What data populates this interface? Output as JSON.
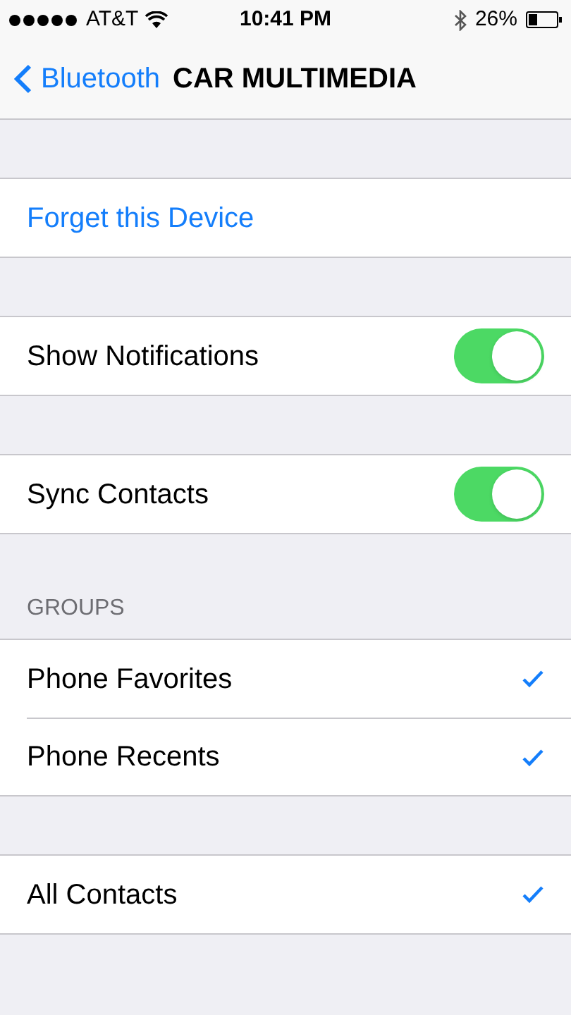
{
  "status_bar": {
    "carrier": "AT&T",
    "time": "10:41 PM",
    "battery": "26%"
  },
  "nav": {
    "back": "Bluetooth",
    "title": "CAR MULTIMEDIA"
  },
  "sections": [
    {
      "rows": [
        {
          "kind": "link",
          "label": "Forget this Device"
        }
      ]
    },
    {
      "rows": [
        {
          "kind": "toggle",
          "label": "Show Notifications",
          "on": true
        }
      ]
    },
    {
      "rows": [
        {
          "kind": "toggle",
          "label": "Sync Contacts",
          "on": true
        }
      ]
    },
    {
      "header": "GROUPS",
      "rows": [
        {
          "kind": "check",
          "label": "Phone Favorites",
          "checked": true
        },
        {
          "kind": "check",
          "label": "Phone Recents",
          "checked": true
        }
      ]
    },
    {
      "rows": [
        {
          "kind": "check",
          "label": "All Contacts",
          "checked": true
        }
      ]
    }
  ]
}
